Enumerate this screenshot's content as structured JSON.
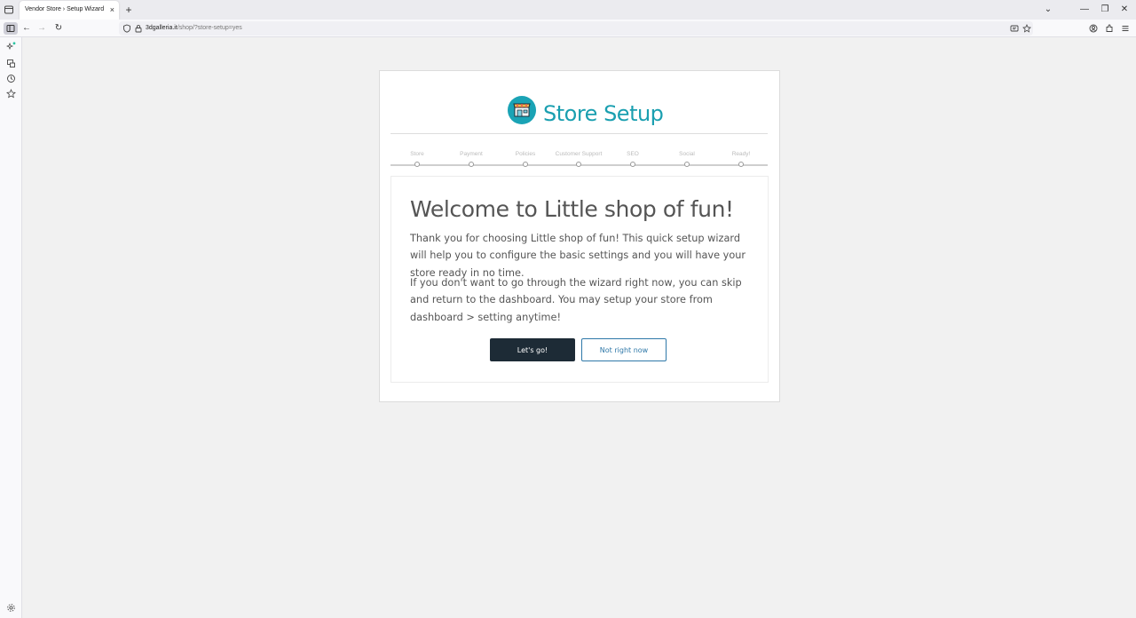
{
  "browser": {
    "tab_title": "Vendor Store › Setup Wizard",
    "tab_close": "×",
    "new_tab": "+",
    "url_host": "3dgalleria.it",
    "url_path": "/shop/?store-setup=yes",
    "win_minimize": "—",
    "win_restore": "❐",
    "win_close": "✕",
    "tab_overflow": "⌄"
  },
  "nav": {
    "back": "←",
    "forward": "→",
    "reload": "↻"
  },
  "setup": {
    "title": "Store Setup",
    "steps": [
      {
        "label": "Store"
      },
      {
        "label": "Payment"
      },
      {
        "label": "Policies"
      },
      {
        "label": "Customer Support"
      },
      {
        "label": "SEO"
      },
      {
        "label": "Social"
      },
      {
        "label": "Ready!"
      }
    ],
    "heading": "Welcome to Little shop of fun!",
    "paragraph1": "Thank you for choosing Little shop of fun! This quick setup wizard will help you to configure the basic settings and you will have your store ready in no time.",
    "paragraph2": "If you don't want to go through the wizard right now, you can skip and return to the dashboard. You may setup your store from dashboard > setting anytime!",
    "go_label": "Let's go!",
    "skip_label": "Not right now"
  },
  "colors": {
    "accent": "#1a9fb0",
    "primary_button": "#1d2b36",
    "link_button": "#2f78a8"
  }
}
